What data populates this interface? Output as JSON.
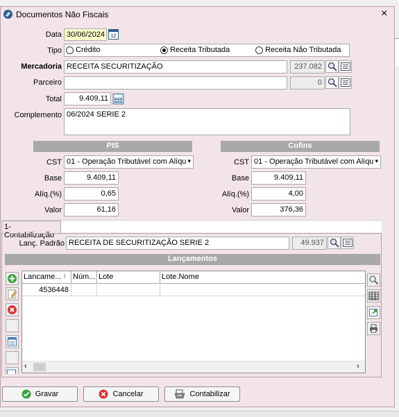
{
  "window": {
    "title": "Documentos Não Fiscais",
    "close_label": "×"
  },
  "form": {
    "data_label": "Data",
    "data_value": "30/06/2024",
    "tipo_label": "Tipo",
    "tipo_options": [
      "Crédito",
      "Receita Tributada",
      "Receita Não Tributada"
    ],
    "tipo_selected": "Receita Tributada",
    "mercadoria_label": "Mercadoria",
    "mercadoria_value": "RECEITA SECURITIZAÇÃO",
    "mercadoria_code": "237.082",
    "parceiro_label": "Parceiro",
    "parceiro_value": "",
    "parceiro_code": "0",
    "total_label": "Total",
    "total_value": "9.409,11",
    "complemento_label": "Complemento",
    "complemento_value": "06/2024 SERIE 2"
  },
  "pis": {
    "header": "PIS",
    "cst_label": "CST",
    "cst_value": "01 - Operação Tributável com Alíqu",
    "base_label": "Base",
    "base_value": "9.409,11",
    "aliq_label": "Alíq.(%)",
    "aliq_value": "0,65",
    "valor_label": "Valor",
    "valor_value": "61,16"
  },
  "cofins": {
    "header": "Cofins",
    "cst_label": "CST",
    "cst_value": "01 - Operação Tributável com Alíqu",
    "base_label": "Base",
    "base_value": "9.409,11",
    "aliq_label": "Alíq.(%)",
    "aliq_value": "4,00",
    "valor_label": "Valor",
    "valor_value": "376,36"
  },
  "tab": {
    "label": "1-Contabilização"
  },
  "lanc_padrao": {
    "label": "Lanç. Padrão",
    "value": "RECEITA DE SECURITIZAÇÃO SERIE 2",
    "code": "49.937"
  },
  "lancamentos": {
    "header": "Lançamentos",
    "columns": [
      "Lancame...",
      "Núm...",
      "Lote",
      "Lote.Nome"
    ],
    "sort_indicator": "/",
    "rows": [
      [
        "4536448",
        "",
        "",
        ""
      ]
    ]
  },
  "actions": {
    "gravar": "Gravar",
    "cancelar": "Cancelar",
    "contabilizar": "Contabilizar"
  },
  "colors": {
    "window_bg": "#f2e4e8",
    "header_bar": "#a9a9a9",
    "date_bg": "#ffffcc"
  }
}
